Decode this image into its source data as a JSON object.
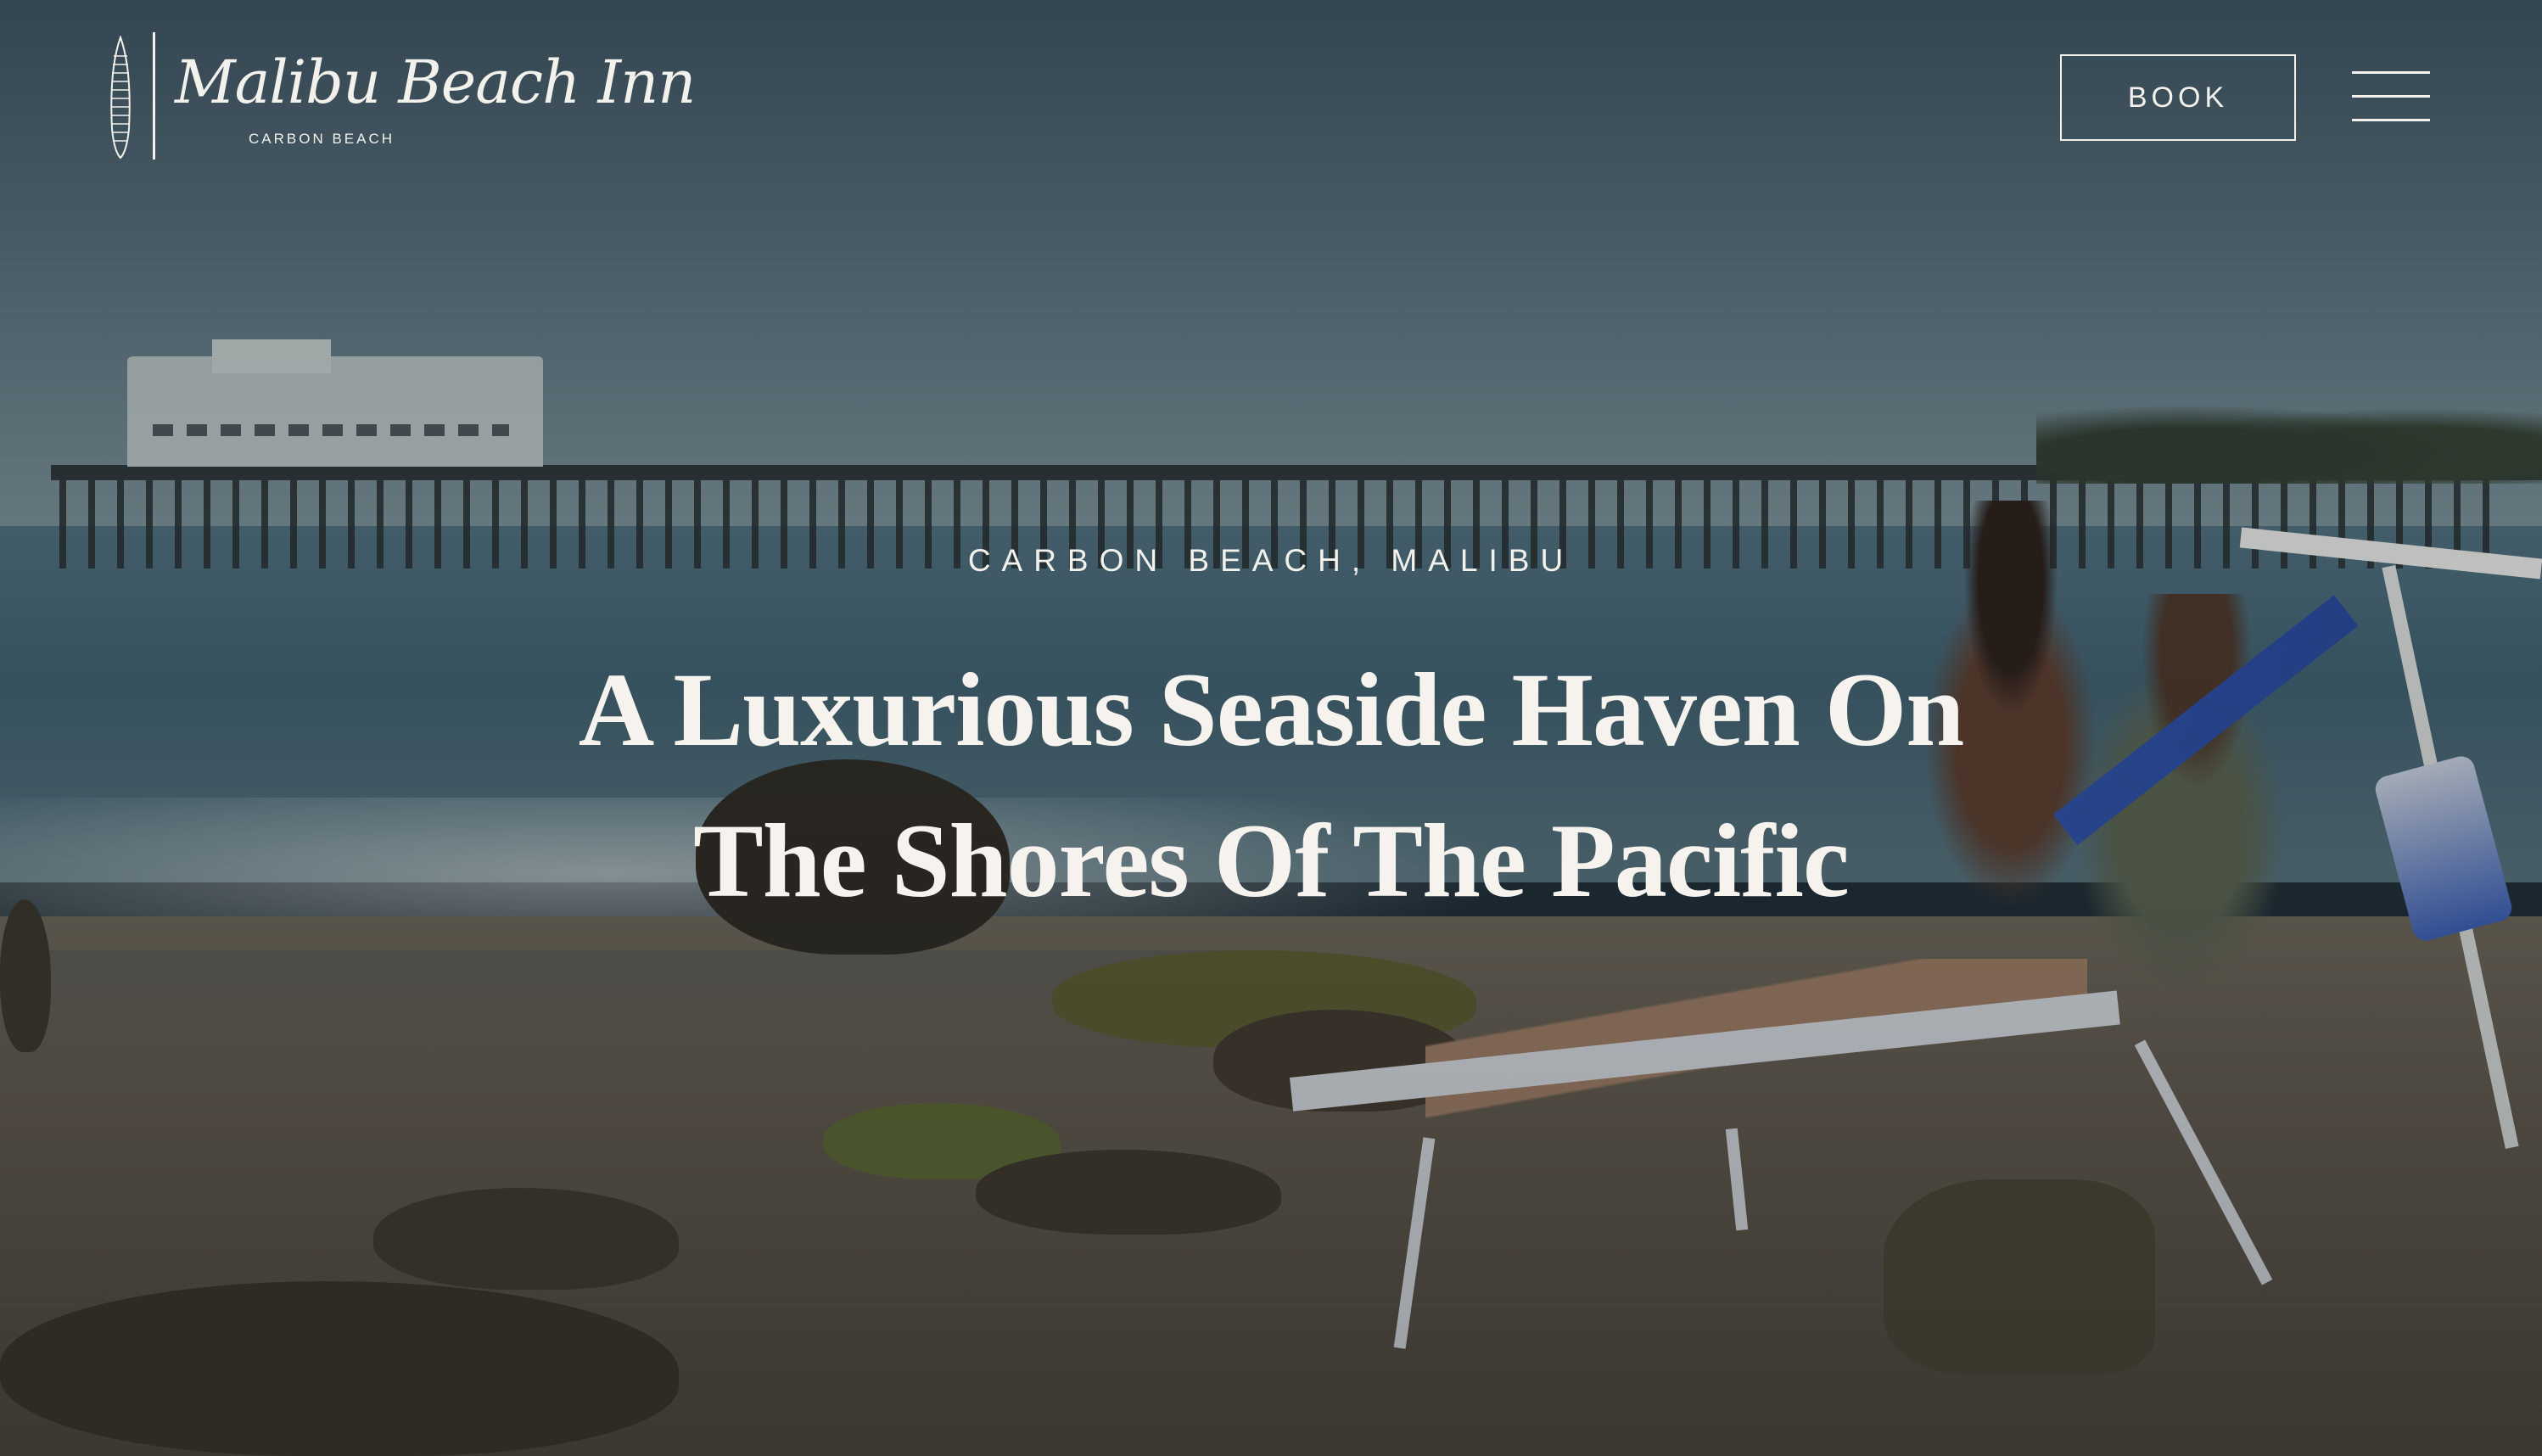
{
  "brand": {
    "name": "Malibu Beach Inn",
    "subtitle": "CARBON BEACH"
  },
  "header": {
    "book_label": "BOOK",
    "menu_icon": "hamburger-menu-icon"
  },
  "hero": {
    "eyebrow": "CARBON BEACH, MALIBU",
    "headline_line1": "A Luxurious Seaside Haven On",
    "headline_line2": "The Shores Of The Pacific"
  },
  "colors": {
    "text": "#f3f1ec",
    "overlay": "#141c22"
  }
}
